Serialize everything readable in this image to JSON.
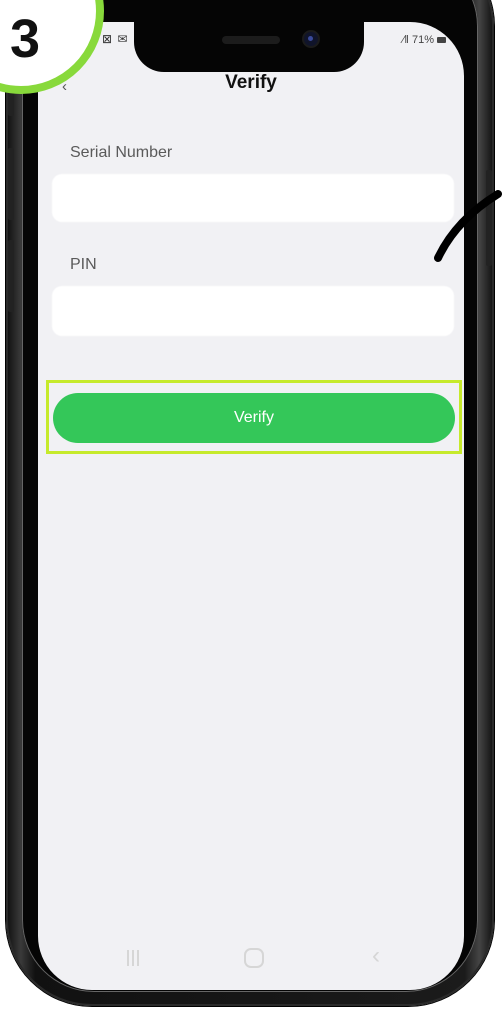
{
  "step_badge": {
    "number": "3"
  },
  "status_bar": {
    "left_icons": "▮ ⊠ ✉",
    "signal": "⁄‖",
    "battery_text": "71%"
  },
  "header": {
    "title": "Verify",
    "back_icon": "chevron-left-icon"
  },
  "form": {
    "serial_number": {
      "label": "Serial Number"
    },
    "pin": {
      "label": "PIN"
    }
  },
  "actions": {
    "verify_label": "Verify"
  },
  "colors": {
    "accent": "#34c759",
    "highlight": "#c6ea2b",
    "badge_ring": "#88d93b",
    "screen_bg": "#f1f1f4"
  },
  "nav": {
    "recents": "recents-icon",
    "home": "home-icon",
    "back": "back-icon"
  }
}
